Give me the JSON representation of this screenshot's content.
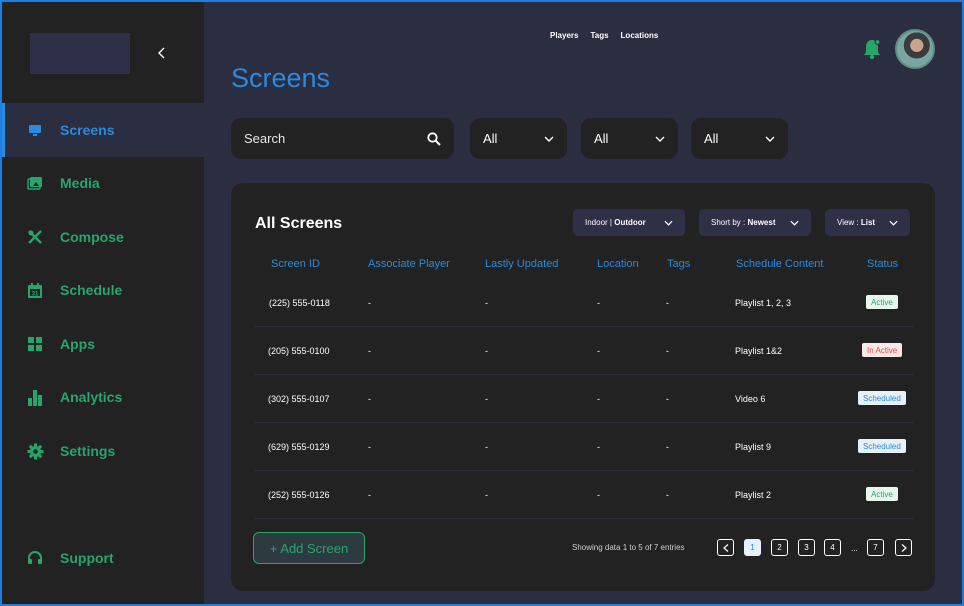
{
  "sidebar": {
    "items": [
      {
        "label": "Screens",
        "icon": "monitor-icon"
      },
      {
        "label": "Media",
        "icon": "media-icon"
      },
      {
        "label": "Compose",
        "icon": "compose-tools-icon"
      },
      {
        "label": "Schedule",
        "icon": "calendar-icon"
      },
      {
        "label": "Apps",
        "icon": "apps-grid-icon"
      },
      {
        "label": "Analytics",
        "icon": "bar-chart-icon"
      },
      {
        "label": "Settings",
        "icon": "gear-icon"
      }
    ],
    "support": {
      "label": "Support",
      "icon": "headset-icon"
    }
  },
  "topnav": {
    "links": [
      "Players",
      "Tags",
      "Locations"
    ]
  },
  "page": {
    "title": "Screens"
  },
  "filters": {
    "search_label": "Search",
    "dropdowns": [
      "All",
      "All",
      "All"
    ]
  },
  "card": {
    "title": "All Screens",
    "toggle": {
      "left": "Indoor",
      "right": "Outdoor"
    },
    "sort": {
      "prefix": "Short by :",
      "value": "Newest"
    },
    "view": {
      "prefix": "View :",
      "value": "List"
    }
  },
  "table": {
    "headers": [
      "Screen ID",
      "Associate Player",
      "Lastly Updated",
      "Location",
      "Tags",
      "Schedule Content",
      "Status"
    ],
    "rows": [
      {
        "id": "(225) 555-0118",
        "player": "-",
        "updated": "-",
        "location": "-",
        "tags": "-",
        "content": "Playlist 1, 2, 3",
        "status": "Active",
        "status_type": "active"
      },
      {
        "id": "(205) 555-0100",
        "player": "-",
        "updated": "-",
        "location": "-",
        "tags": "-",
        "content": "Playlist 1&2",
        "status": "In Active",
        "status_type": "inactive"
      },
      {
        "id": "(302) 555-0107",
        "player": "-",
        "updated": "-",
        "location": "-",
        "tags": "-",
        "content": "Video 6",
        "status": "Scheduled",
        "status_type": "scheduled"
      },
      {
        "id": "(629) 555-0129",
        "player": "-",
        "updated": "-",
        "location": "-",
        "tags": "-",
        "content": "Playlist 9",
        "status": "Scheduled",
        "status_type": "scheduled"
      },
      {
        "id": "(252) 555-0126",
        "player": "-",
        "updated": "-",
        "location": "-",
        "tags": "-",
        "content": "Playlist 2",
        "status": "Active",
        "status_type": "active"
      }
    ]
  },
  "footer": {
    "add_button": "+ Add Screen",
    "entries": "Showing data 1 to 5 of  7 entries",
    "pages": [
      "1",
      "2",
      "3",
      "4",
      "7"
    ],
    "current_page": "1",
    "ellipsis": "..."
  },
  "colors": {
    "accent_blue": "#2a8adf",
    "accent_green": "#27a56b",
    "background": "#2b2d40",
    "panel": "#222222"
  }
}
